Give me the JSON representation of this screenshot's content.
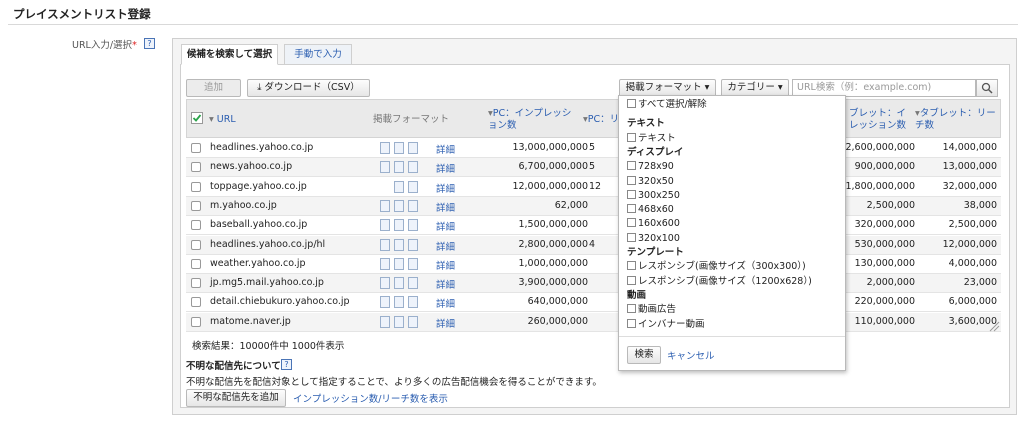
{
  "page_title": "プレイスメントリスト登録",
  "field": {
    "label": "URL入力/選択",
    "required_mark": "*",
    "help": "?"
  },
  "tabs": [
    {
      "label": "候補を検索して選択"
    },
    {
      "label": "手動で入力"
    }
  ],
  "toolbar": {
    "add": "追加",
    "download": "ダウンロード（CSV）",
    "format_dropdown": "掲載フォーマット ▾",
    "category_dropdown": "カテゴリー ▾",
    "search_placeholder": "URL検索（例：example.com)"
  },
  "table": {
    "headers": {
      "url": "URL",
      "format": "掲載フォーマット",
      "pc_imp_1": "PC：インプレッシ",
      "pc_imp_2": "ョン数",
      "pc_reach": "PC：リ",
      "tab_imp_1": "ブレット：イ",
      "tab_imp_2": "レッション数",
      "tab_reach_1": "タブレット：リー",
      "tab_reach_2": "チ数"
    },
    "rows": [
      {
        "url": "headlines.yahoo.co.jp",
        "detail": "詳細",
        "pc_imp": "13,000,000,000",
        "pc_reach": "5",
        "tab_imp": "2,600,000,000",
        "tab_reach": "14,000,000"
      },
      {
        "url": "news.yahoo.co.jp",
        "detail": "詳細",
        "pc_imp": "6,700,000,000",
        "pc_reach": "5",
        "tab_imp": "900,000,000",
        "tab_reach": "13,000,000"
      },
      {
        "url": "toppage.yahoo.co.jp",
        "detail": "詳細",
        "pc_imp": "12,000,000,000",
        "pc_reach": "12",
        "tab_imp": "1,800,000,000",
        "tab_reach": "32,000,000"
      },
      {
        "url": "m.yahoo.co.jp",
        "detail": "詳細",
        "pc_imp": "62,000",
        "pc_reach": "",
        "tab_imp": "2,500,000",
        "tab_reach": "38,000"
      },
      {
        "url": "baseball.yahoo.co.jp",
        "detail": "詳細",
        "pc_imp": "1,500,000,000",
        "pc_reach": "",
        "tab_imp": "320,000,000",
        "tab_reach": "2,500,000"
      },
      {
        "url": "headlines.yahoo.co.jp/hl",
        "detail": "詳細",
        "pc_imp": "2,800,000,000",
        "pc_reach": "4",
        "tab_imp": "530,000,000",
        "tab_reach": "12,000,000"
      },
      {
        "url": "weather.yahoo.co.jp",
        "detail": "詳細",
        "pc_imp": "1,000,000,000",
        "pc_reach": "",
        "tab_imp": "130,000,000",
        "tab_reach": "4,000,000"
      },
      {
        "url": "jp.mg5.mail.yahoo.co.jp",
        "detail": "詳細",
        "pc_imp": "3,900,000,000",
        "pc_reach": "",
        "tab_imp": "2,000,000",
        "tab_reach": "23,000"
      },
      {
        "url": "detail.chiebukuro.yahoo.co.jp",
        "detail": "詳細",
        "pc_imp": "640,000,000",
        "pc_reach": "",
        "tab_imp": "220,000,000",
        "tab_reach": "6,000,000"
      },
      {
        "url": "matome.naver.jp",
        "detail": "詳細",
        "pc_imp": "260,000,000",
        "pc_reach": "",
        "tab_imp": "110,000,000",
        "tab_reach": "3,600,000"
      }
    ]
  },
  "result_text": "検索結果：10000件中 1000件表示",
  "unknown": {
    "title": "不明な配信先について",
    "description": "不明な配信先を配信対象として指定することで、より多くの広告配信機会を得ることができます。",
    "add_button": "不明な配信先を追加",
    "show_link": "インプレッション数/リーチ数を表示"
  },
  "format_menu": {
    "select_all": "すべて選択/解除",
    "sections": [
      {
        "heading": "テキスト",
        "items": [
          "テキスト"
        ]
      },
      {
        "heading": "ディスプレイ",
        "items": [
          "728x90",
          "320x50",
          "300x250",
          "468x60",
          "160x600",
          "320x100"
        ]
      },
      {
        "heading": "テンプレート",
        "items": [
          "レスポンシブ(画像サイズ（300x300）)",
          "レスポンシブ(画像サイズ（1200x628）)"
        ]
      },
      {
        "heading": "動画",
        "items": [
          "動画広告",
          "インバナー動画"
        ]
      }
    ],
    "search": "検索",
    "cancel": "キャンセル"
  },
  "colors": {
    "link": "#2a5db0",
    "header_bg": "#eaeaea",
    "check": "#2aa34a"
  }
}
